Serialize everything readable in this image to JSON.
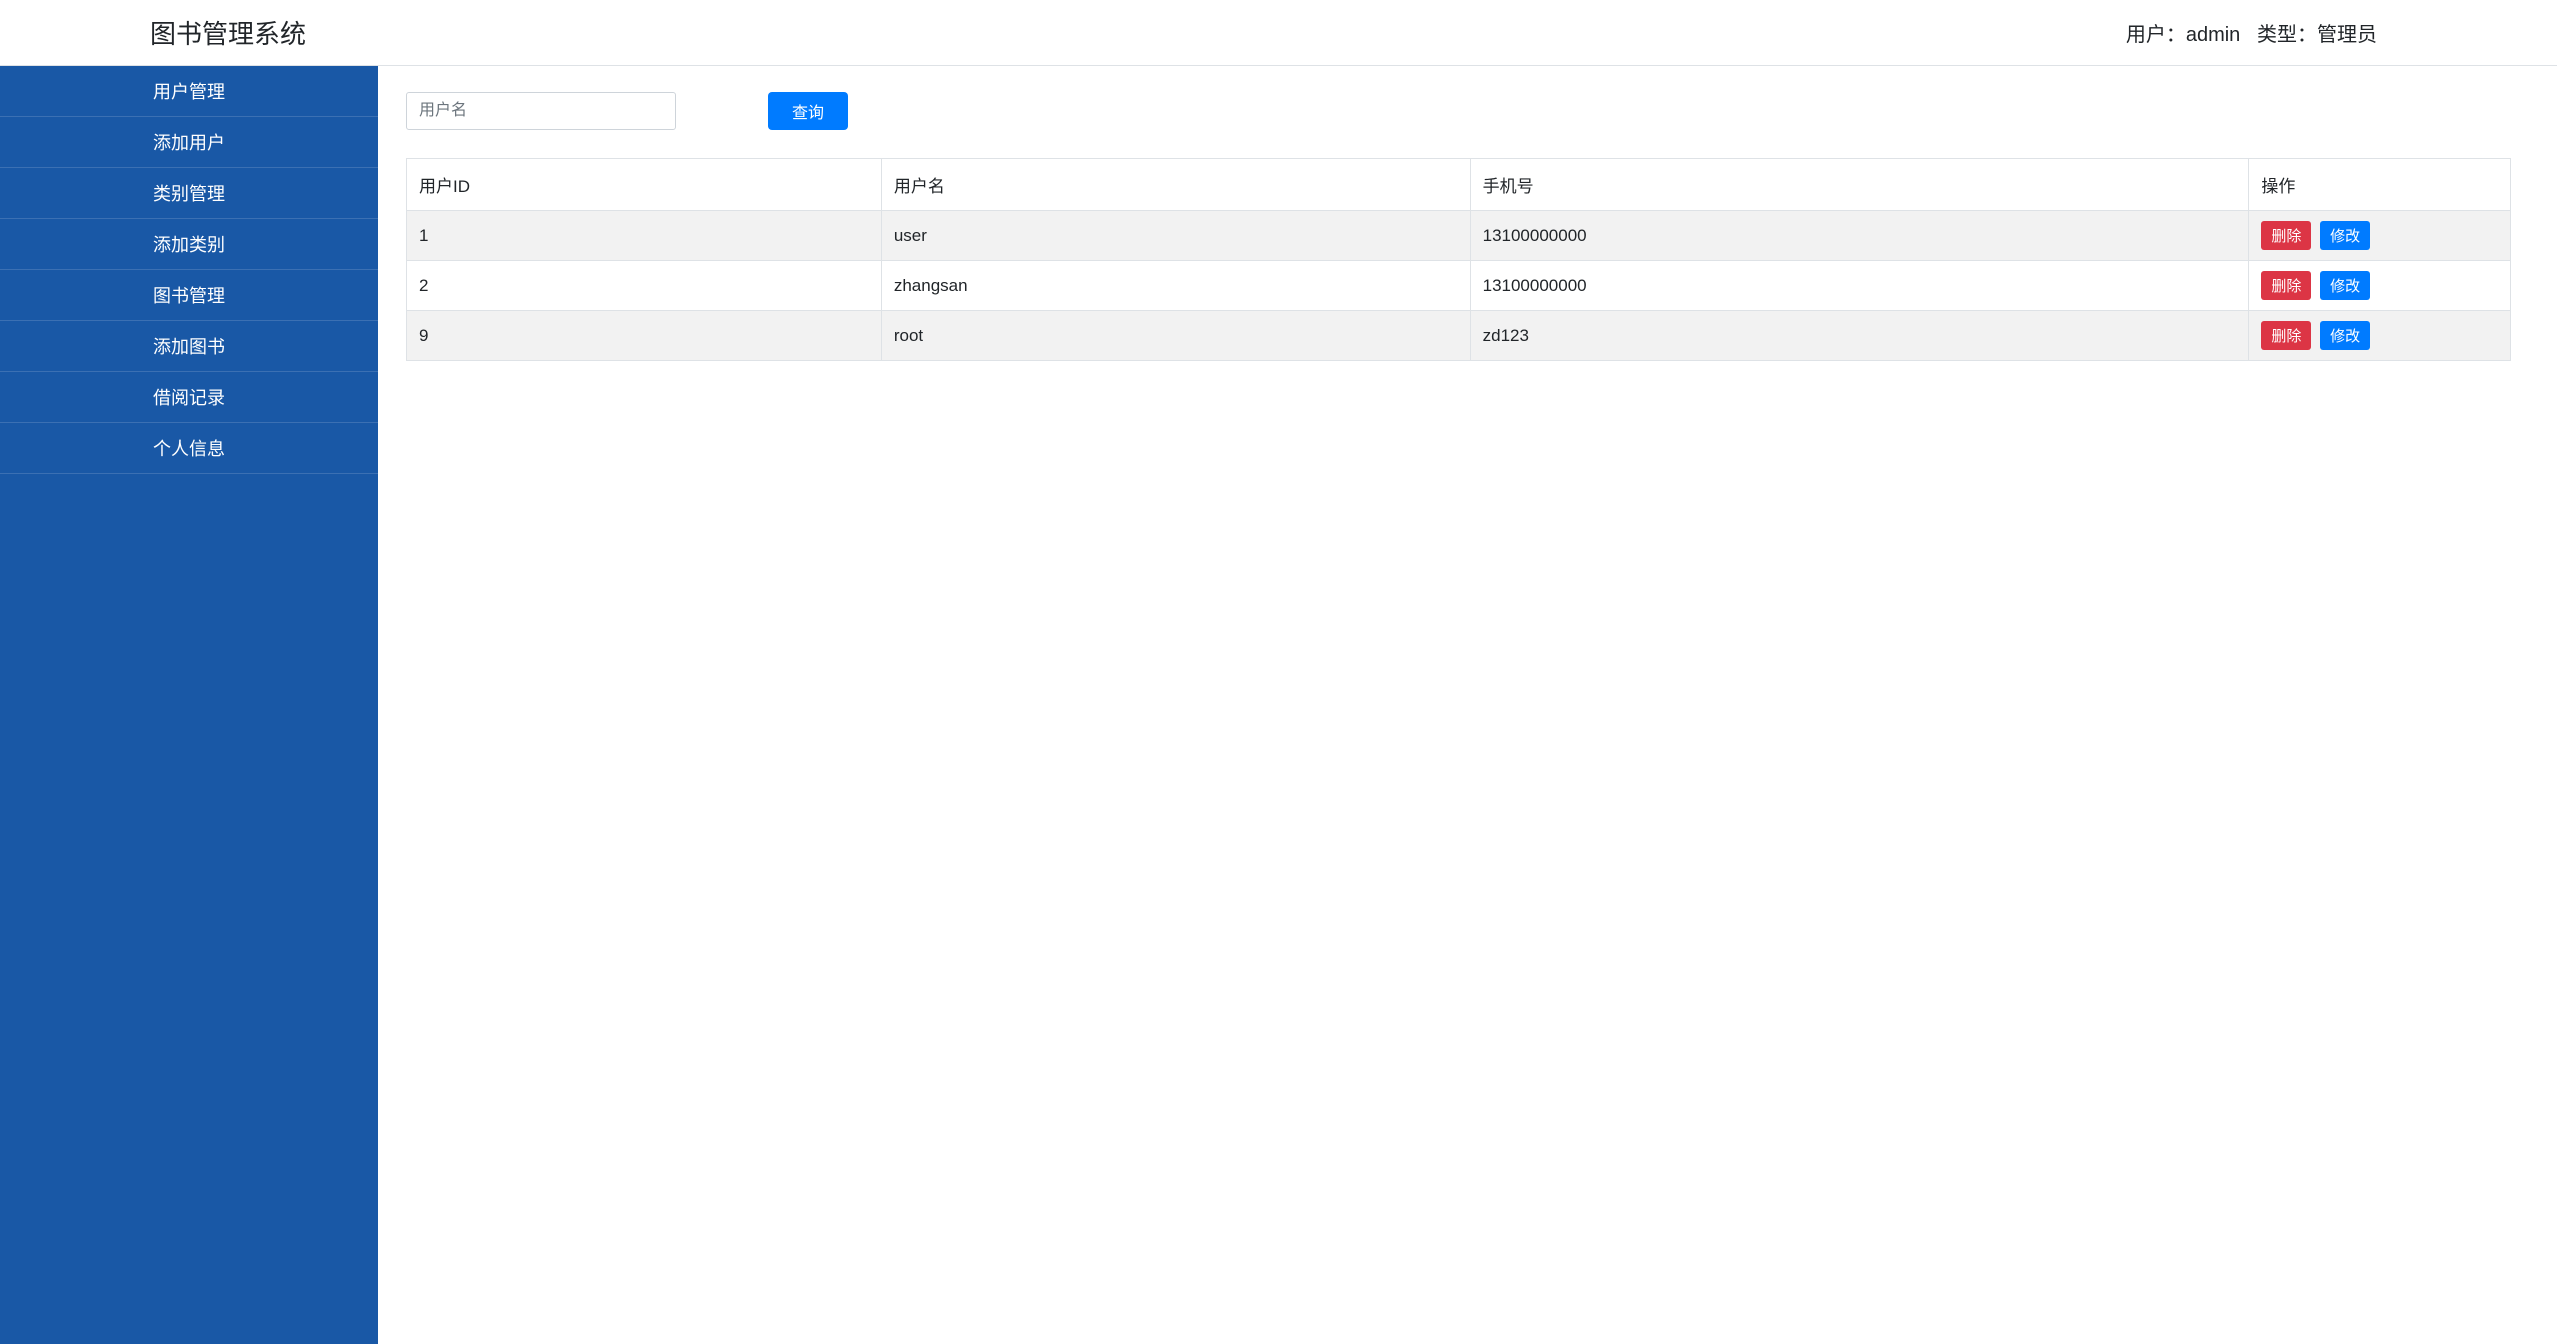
{
  "header": {
    "title": "图书管理系统",
    "user_label": "用户：",
    "user_name": "admin",
    "type_label": "类型：",
    "type_value": "管理员"
  },
  "sidebar": {
    "items": [
      {
        "label": "用户管理"
      },
      {
        "label": "添加用户"
      },
      {
        "label": "类别管理"
      },
      {
        "label": "添加类别"
      },
      {
        "label": "图书管理"
      },
      {
        "label": "添加图书"
      },
      {
        "label": "借阅记录"
      },
      {
        "label": "个人信息"
      }
    ]
  },
  "search": {
    "placeholder": "用户名",
    "value": "",
    "button_label": "查询"
  },
  "table": {
    "columns": [
      {
        "label": "用户ID"
      },
      {
        "label": "用户名"
      },
      {
        "label": "手机号"
      },
      {
        "label": "操作"
      }
    ],
    "rows": [
      {
        "id": "1",
        "name": "user",
        "phone": "13100000000"
      },
      {
        "id": "2",
        "name": "zhangsan",
        "phone": "13100000000"
      },
      {
        "id": "9",
        "name": "root",
        "phone": "zd123"
      }
    ],
    "actions": {
      "delete_label": "删除",
      "edit_label": "修改"
    }
  }
}
